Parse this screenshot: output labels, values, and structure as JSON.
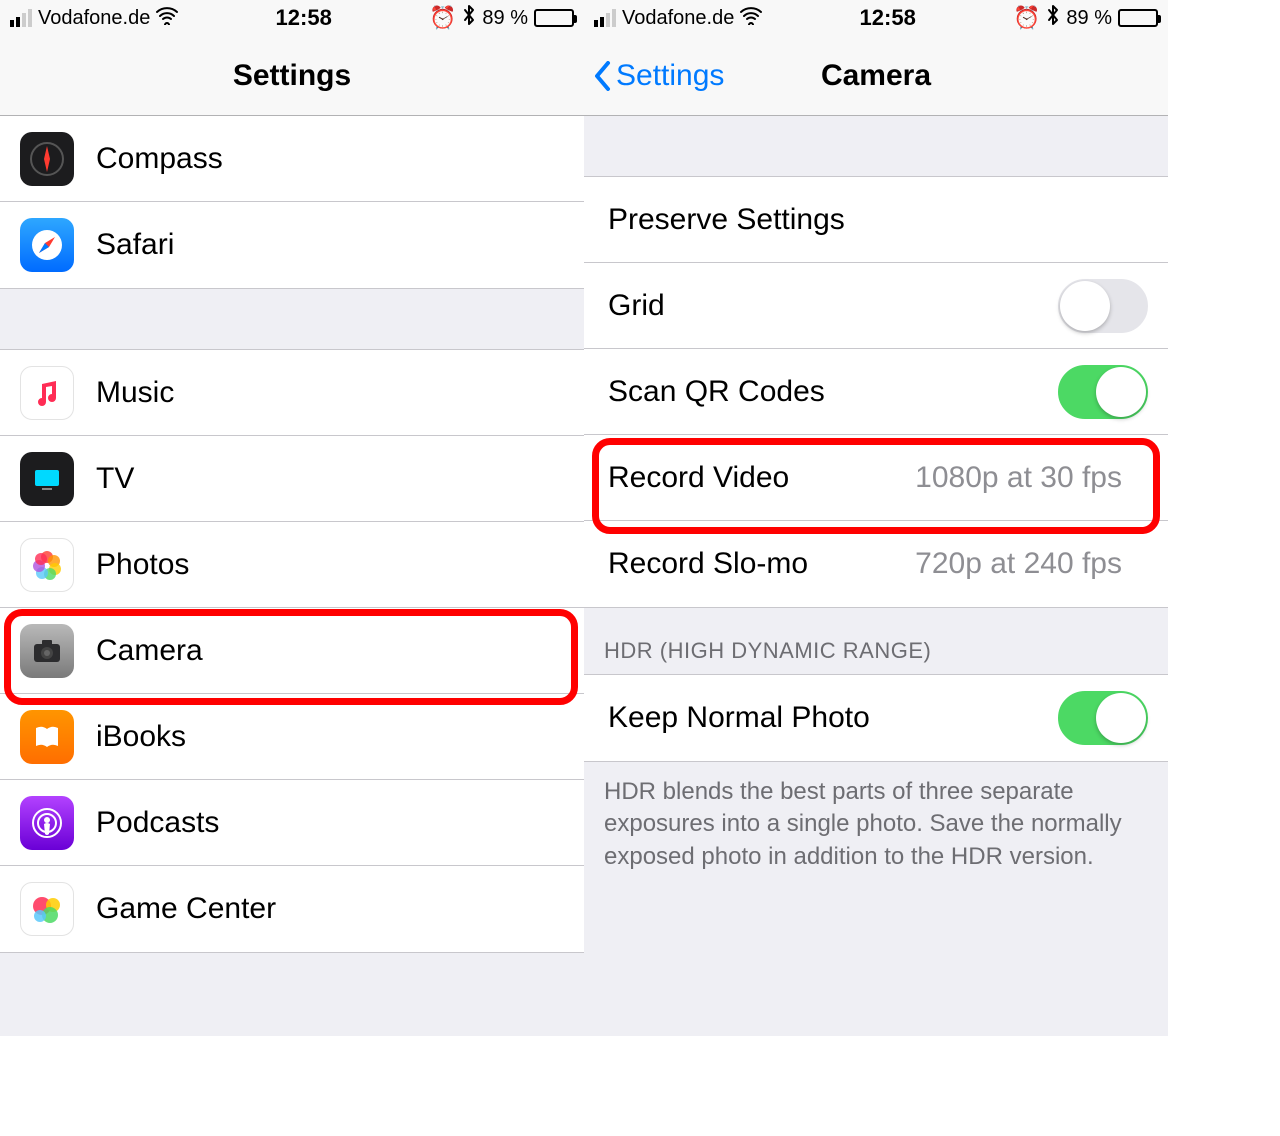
{
  "status": {
    "carrier": "Vodafone.de",
    "time": "12:58",
    "battery_pct": "89 %"
  },
  "left": {
    "title": "Settings",
    "group1": [
      {
        "id": "compass",
        "label": "Compass"
      },
      {
        "id": "safari",
        "label": "Safari"
      }
    ],
    "group2": [
      {
        "id": "music",
        "label": "Music"
      },
      {
        "id": "tv",
        "label": "TV"
      },
      {
        "id": "photos",
        "label": "Photos"
      },
      {
        "id": "camera",
        "label": "Camera"
      },
      {
        "id": "ibooks",
        "label": "iBooks"
      },
      {
        "id": "podcasts",
        "label": "Podcasts"
      },
      {
        "id": "gamecenter",
        "label": "Game Center"
      }
    ]
  },
  "right": {
    "back": "Settings",
    "title": "Camera",
    "rows": {
      "preserve": {
        "label": "Preserve Settings"
      },
      "grid": {
        "label": "Grid",
        "on": false
      },
      "scanqr": {
        "label": "Scan QR Codes",
        "on": true
      },
      "record_video": {
        "label": "Record Video",
        "detail": "1080p at 30 fps"
      },
      "record_slomo": {
        "label": "Record Slo-mo",
        "detail": "720p at 240 fps"
      }
    },
    "hdr_header": "HDR (HIGH DYNAMIC RANGE)",
    "hdr": {
      "keep_normal": {
        "label": "Keep Normal Photo",
        "on": true
      },
      "footer": "HDR blends the best parts of three separate exposures into a single photo. Save the normally exposed photo in addition to the HDR version."
    }
  }
}
